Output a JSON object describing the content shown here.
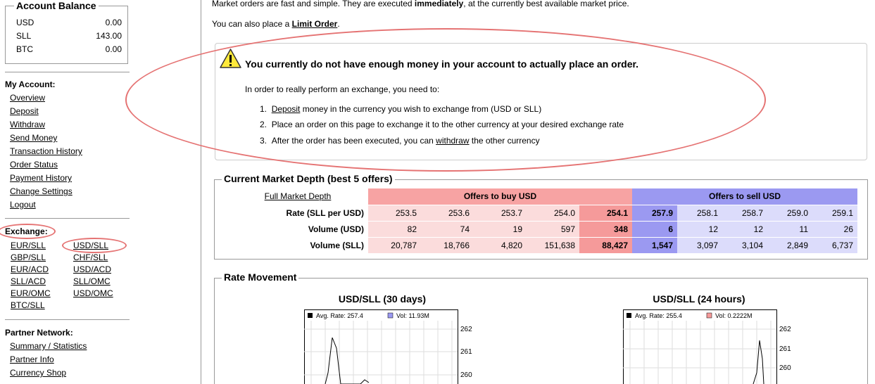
{
  "sidebar": {
    "balance_title": "Account Balance",
    "balances": [
      {
        "currency": "USD",
        "amount": "0.00"
      },
      {
        "currency": "SLL",
        "amount": "143.00"
      },
      {
        "currency": "BTC",
        "amount": "0.00"
      }
    ],
    "my_account_head": "My Account:",
    "my_account_links": [
      "Overview",
      "Deposit",
      "Withdraw",
      "Send Money",
      "Transaction History",
      "Order Status",
      "Payment History",
      "Change Settings",
      "Logout"
    ],
    "exchange_head": "Exchange:",
    "exchange_links": [
      [
        "EUR/SLL",
        "USD/SLL"
      ],
      [
        "GBP/SLL",
        "CHF/SLL"
      ],
      [
        "EUR/ACD",
        "USD/ACD"
      ],
      [
        "SLL/ACD",
        "SLL/OMC"
      ],
      [
        "EUR/OMC",
        "USD/OMC"
      ],
      [
        "BTC/SLL",
        ""
      ]
    ],
    "partner_head": "Partner Network:",
    "partner_links": [
      "Summary / Statistics",
      "Partner Info",
      "Currency Shop"
    ]
  },
  "main": {
    "intro_prefix": "Market orders are fast and simple. They are executed ",
    "intro_bold": "immediately",
    "intro_suffix": ", at the currently best available market price.",
    "limit_prefix": "You can also place a ",
    "limit_link": "Limit Order",
    "limit_suffix": ".",
    "warning_title": "You currently do not have enough money in your account to actually place an order.",
    "warning_text": "In order to really perform an exchange, you need to:",
    "steps": [
      {
        "num": "1.",
        "link": "Deposit",
        "text": " money in the currency you wish to exchange from (USD or SLL)"
      },
      {
        "num": "2.",
        "link": "",
        "text": "Place an order on this page to exchange it to the other currency at your desired exchange rate"
      },
      {
        "num": "3.",
        "pre": "After the order has been executed, you can ",
        "link": "withdraw",
        "text": " the other currency"
      }
    ]
  },
  "depth": {
    "title": "Current Market Depth (best 5 offers)",
    "full_link": "Full Market Depth",
    "buy_head": "Offers to buy USD",
    "sell_head": "Offers to sell USD",
    "rows": [
      {
        "label": "Rate (SLL per USD)",
        "buy": [
          "253.5",
          "253.6",
          "253.7",
          "254.0",
          "254.1"
        ],
        "sell": [
          "257.9",
          "258.1",
          "258.7",
          "259.0",
          "259.1"
        ]
      },
      {
        "label": "Volume (USD)",
        "buy": [
          "82",
          "74",
          "19",
          "597",
          "348"
        ],
        "sell": [
          "6",
          "12",
          "12",
          "11",
          "26"
        ]
      },
      {
        "label": "Volume (SLL)",
        "buy": [
          "20,787",
          "18,766",
          "4,820",
          "151,638",
          "88,427"
        ],
        "sell": [
          "1,547",
          "3,097",
          "3,104",
          "2,849",
          "6,737"
        ]
      }
    ]
  },
  "rate_movement": {
    "title": "Rate Movement",
    "charts": [
      {
        "title": "USD/SLL (30 days)",
        "legend_avg": "Avg. Rate: 257.4",
        "legend_vol": "Vol: 11.93M",
        "ticks": [
          "262",
          "261",
          "260"
        ]
      },
      {
        "title": "USD/SLL (24 hours)",
        "legend_avg": "Avg. Rate: 255.4",
        "legend_vol": "Vol: 0.2222M",
        "ticks": [
          "262",
          "261",
          "260"
        ]
      }
    ]
  },
  "colors": {
    "annotation": "#e57373",
    "buy_bg": "#fbdcdc",
    "buy_best": "#f59a9a",
    "sell_bg": "#dcdcfb",
    "sell_best": "#9b99f1"
  }
}
